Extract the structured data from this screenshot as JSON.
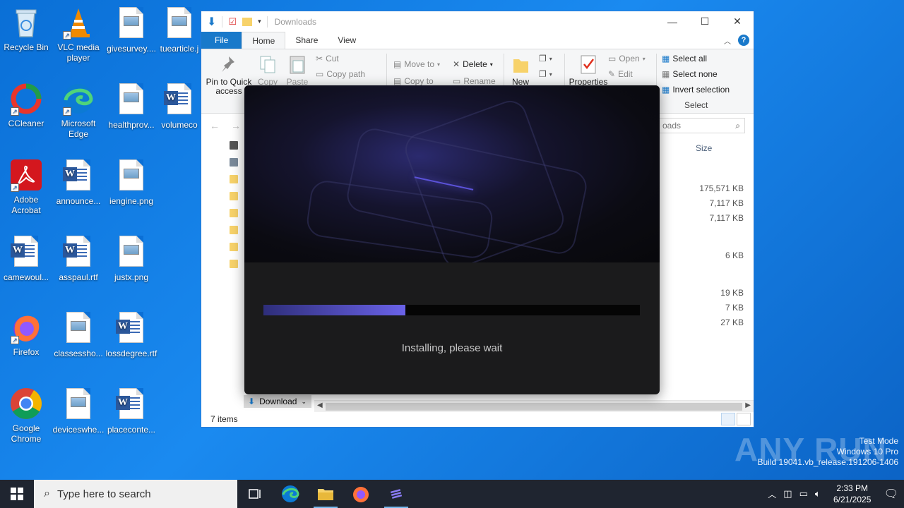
{
  "desktop": {
    "icons": [
      {
        "label": "Recycle Bin"
      },
      {
        "label": "VLC media player"
      },
      {
        "label": "givesurvey...."
      },
      {
        "label": "tuearticle.j"
      },
      {
        "label": "CCleaner"
      },
      {
        "label": "Microsoft Edge"
      },
      {
        "label": "healthprov..."
      },
      {
        "label": "volumeco"
      },
      {
        "label": "Adobe Acrobat"
      },
      {
        "label": "announce..."
      },
      {
        "label": "iengine.png"
      },
      {
        "label": "camewoul..."
      },
      {
        "label": "asspaul.rtf"
      },
      {
        "label": "justx.png"
      },
      {
        "label": "Firefox"
      },
      {
        "label": "classessho..."
      },
      {
        "label": "lossdegree.rtf"
      },
      {
        "label": "Google Chrome"
      },
      {
        "label": "deviceswhe..."
      },
      {
        "label": "placeconte..."
      }
    ]
  },
  "explorer": {
    "title": "Downloads",
    "tabs": {
      "file": "File",
      "home": "Home",
      "share": "Share",
      "view": "View"
    },
    "ribbon": {
      "pin": "Pin to Quick access",
      "copy": "Copy",
      "paste": "Paste",
      "cut": "Cut",
      "copy_path": "Copy path",
      "move_to": "Move to",
      "copy_to": "Copy to",
      "delete": "Delete",
      "rename": "Rename",
      "new": "New",
      "properties": "Properties",
      "open": "Open",
      "edit": "Edit",
      "select_all": "Select all",
      "select_none": "Select none",
      "invert_selection": "Invert selection",
      "select_group": "Select"
    },
    "search_placeholder": "oads",
    "column_size": "Size",
    "sizes": [
      "175,571 KB",
      "7,117 KB",
      "7,117 KB",
      "6 KB",
      "19 KB",
      "7 KB",
      "27 KB"
    ],
    "nav_download": "Download",
    "status": "7 items"
  },
  "installer": {
    "status_text": "Installing, please wait",
    "progress": 0.377
  },
  "watermark": {
    "brand": "ANY RUN",
    "line1": "Test Mode",
    "line2": "Windows 10 Pro",
    "line3": "Build 19041.vb_release.191206-1406"
  },
  "taskbar": {
    "search_placeholder": "Type here to search",
    "time": "2:33 PM",
    "date": "6/21/2025"
  },
  "colors": {
    "desktop": "#0a6fd6",
    "accent": "#1979ca",
    "progress": "#6a62e8",
    "taskbar": "#1f2530"
  }
}
